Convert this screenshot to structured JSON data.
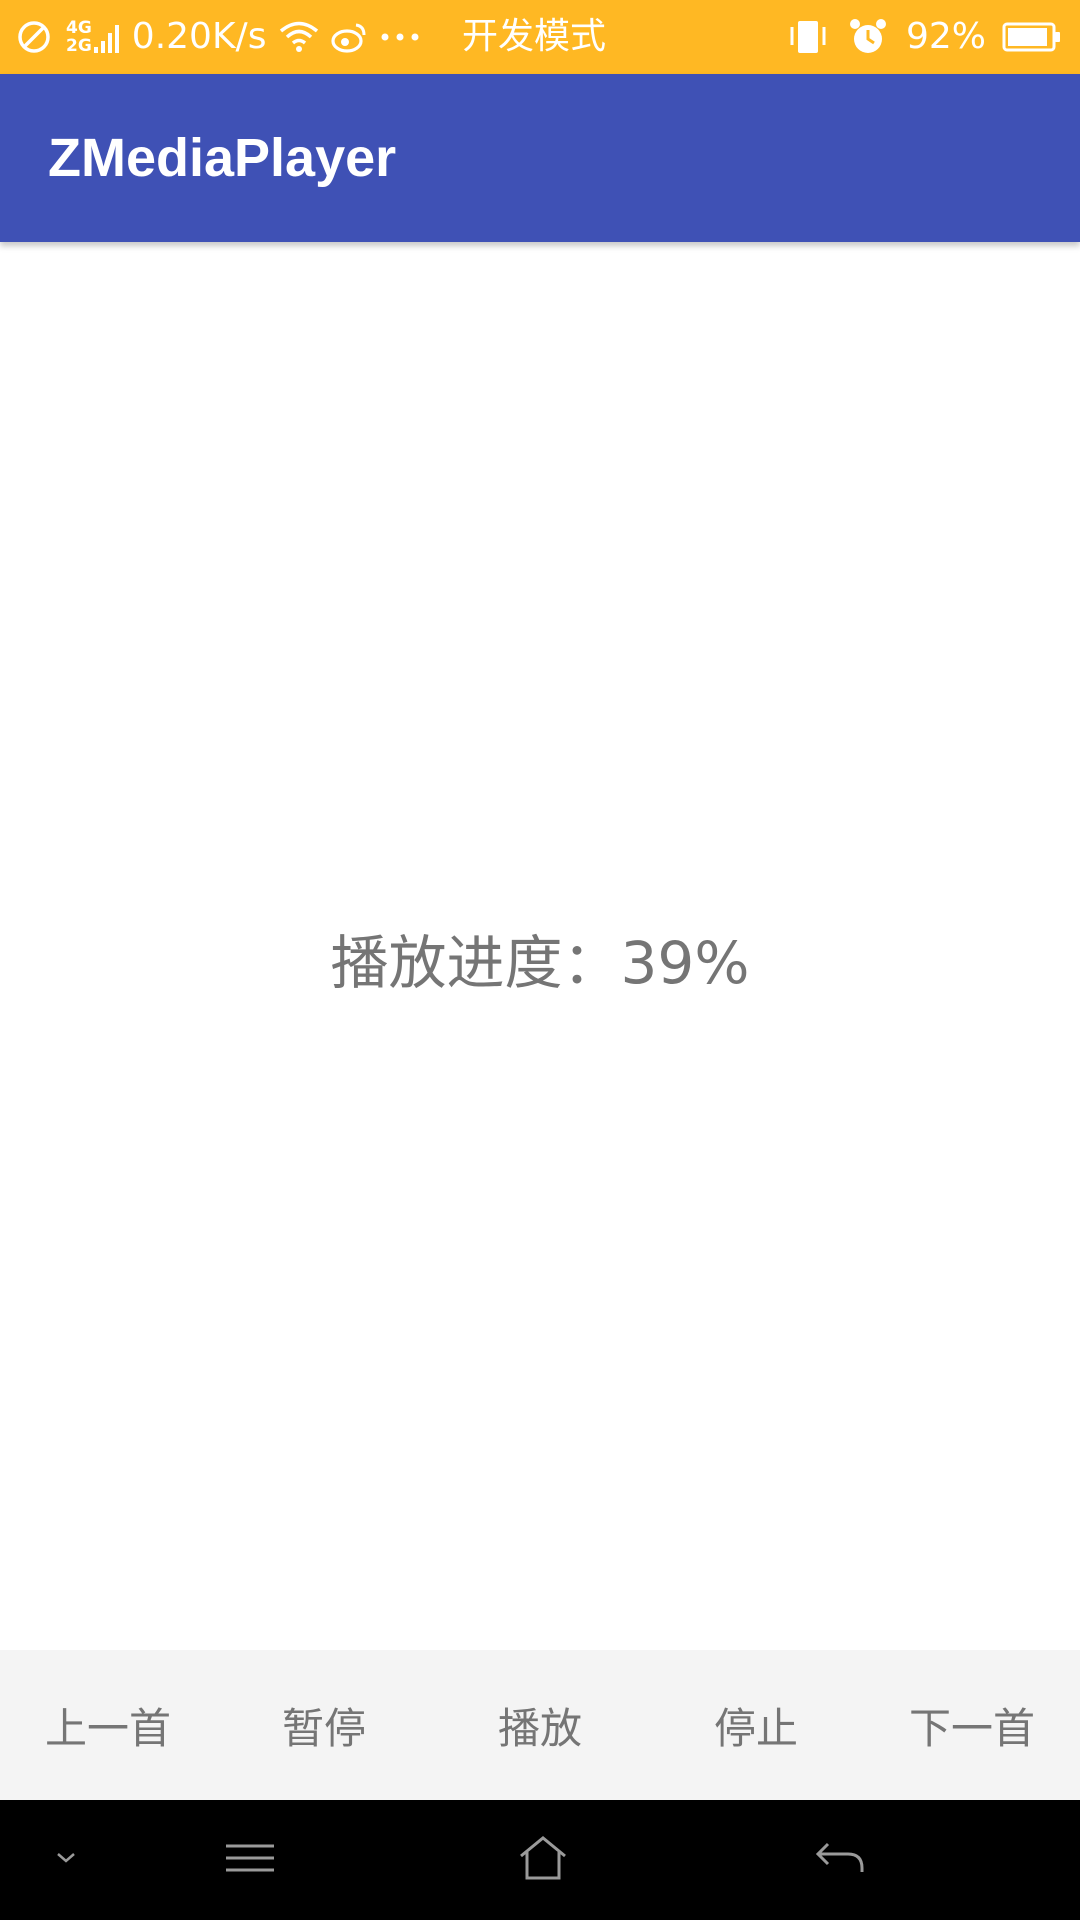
{
  "status_bar": {
    "network_type_top": "4G",
    "network_type_bottom": "2G",
    "speed": "0.20K/s",
    "mode": "开发模式",
    "battery": "92%",
    "icons": [
      "do-not-disturb-icon",
      "signal-icon",
      "wifi-icon",
      "weibo-icon",
      "more-dots-icon",
      "vibrate-icon",
      "alarm-icon",
      "battery-icon"
    ],
    "battery_level": 0.92,
    "background_color": "#FFB823"
  },
  "app_bar": {
    "title": "ZMediaPlayer",
    "background_color": "#3F51B5"
  },
  "main": {
    "progress_text": "播放进度：39%",
    "progress_percent": 39
  },
  "controls": {
    "previous_label": "上一首",
    "pause_label": "暂停",
    "play_label": "播放",
    "stop_label": "停止",
    "next_label": "下一首"
  },
  "nav_bar": {
    "icons": [
      "collapse-down-icon",
      "menu-icon",
      "home-icon",
      "back-icon"
    ]
  }
}
